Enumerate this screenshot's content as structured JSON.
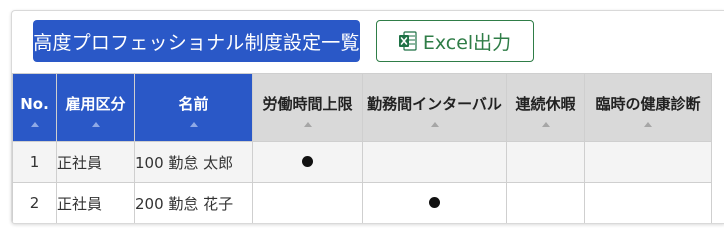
{
  "toolbar": {
    "settings_list_label": "高度プロフェッショナル制度設定一覧",
    "excel_label": "Excel出力"
  },
  "table": {
    "columns": [
      {
        "label": "No."
      },
      {
        "label": "雇用区分"
      },
      {
        "label": "名前"
      },
      {
        "label": "労働時間上限"
      },
      {
        "label": "勤務間インターバル"
      },
      {
        "label": "連続休暇"
      },
      {
        "label": "臨時の健康診断"
      }
    ],
    "rows": [
      {
        "no": "1",
        "kubun": "正社員",
        "name": "100 勤怠 太郎",
        "rodo_jikan_jogen": true,
        "kinmukan_interval": false,
        "renzoku_kyuka": false,
        "rinji_kenko_shindan": false
      },
      {
        "no": "2",
        "kubun": "正社員",
        "name": "200 勤怠 花子",
        "rodo_jikan_jogen": false,
        "kinmukan_interval": true,
        "renzoku_kyuka": false,
        "rinji_kenko_shindan": false
      }
    ],
    "mark_symbol": "●"
  },
  "colors": {
    "primary_blue": "#2a58c7",
    "excel_green": "#2f7d47",
    "header_gray": "#d9d9d9"
  },
  "icons": {
    "excel": "excel-icon",
    "sort": "sort-ascending-icon"
  }
}
